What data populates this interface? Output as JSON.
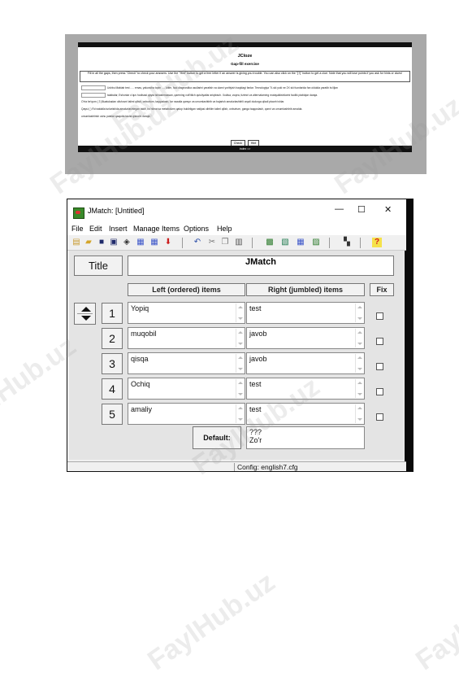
{
  "jcloze": {
    "title": "JCloze",
    "subtitle": "Gap-fill exercise",
    "instructions": "Fill in all the gaps, then press \"Check\" to check your answers. Use the \"Hint\" button to get a free letter if an answer is giving you trouble. You can also click on the \"[?]\" button to get a clue. Note that you will lose points if you ask for hints or clues!",
    "lines": [
      "Ushbu Maktab test ..... emas, yakuncha topin ..... kitim, faol diagnostika usullarini yaratish va ularni yoritiyish haqidagi fanlar. Texnologiya \"X-ski yoki ne 2X ski fuonlarida fan oldulda yaratib bu'ijlan",
      "talabalar, Eshonlar o'quv hodisasi qayta ishlashmassan, qaerning xolt'itilch qutuliyatlar ariqtirach. Xodisa, voqea, tizimni va alternalarning mutayalkishilarini faollik ptablqlar daraja.",
      "O'rta be'qum ( 3 )Buatukadan olishuvni taliml qilish, onburtum, taqqoslash, lar nazaila qarsyn va umumlashtirib va bajarish amalurlashtirili orqali dudurga qiladi ptaorb ishlar.",
      "Qaysi ( ) Ro'xatdalla turlarishida amalurlashtirgan taklif, bo'nilma va metabolizm qatop buldirilgan natijasi olirtiilm taliml qilish, onburtum, ganga taqqoslash, qonni va umumlashtirib amalda.",
      "umumlashtirish ushu paislar qaapdia taolla qilaxchi daraja."
    ],
    "buttons": [
      "Check",
      "Hint"
    ],
    "nav": "Index  =>"
  },
  "window": {
    "title": "JMatch: [Untitled]",
    "controls": [
      "—",
      "☐",
      "✕"
    ]
  },
  "menu": [
    "File",
    "Edit",
    "Insert",
    "Manage Items",
    "Options",
    "Help"
  ],
  "toolbar_icons": [
    "new-document-icon",
    "open-folder-icon",
    "save-icon",
    "save-as-icon",
    "eraser-icon",
    "export-web-icon",
    "export-web-v6-icon",
    "red-arrow-icon",
    "undo-icon",
    "cut-icon",
    "copy-icon",
    "paste-icon",
    "reading-text-icon",
    "config-icon",
    "grid-icon",
    "tools-icon",
    "slides-icon",
    "help-icon"
  ],
  "title_button": "Title",
  "title_value": "JMatch",
  "headers": {
    "left": "Left (ordered) items",
    "right": "Right (jumbled) items",
    "fix": "Fix"
  },
  "rows": [
    {
      "num": "1",
      "left": "Yopiq",
      "right": "test"
    },
    {
      "num": "2",
      "left": "muqobil",
      "right": "javob"
    },
    {
      "num": "3",
      "left": "qisqa",
      "right": "javob"
    },
    {
      "num": "4",
      "left": "Ochiq",
      "right": "test"
    },
    {
      "num": "5",
      "left": "amaliy",
      "right": "test"
    }
  ],
  "default": {
    "label": "Default:",
    "line1": "???",
    "line2": "Zo'r"
  },
  "statusbar": "Config: english7.cfg",
  "watermark": "FaylHub.uz",
  "colors": {
    "window_bg": "#f0f0f0",
    "panel_bg": "#e4e4e4",
    "jcloze_bg": "#a9a9a9",
    "fix_arrow": "#2a4a9a"
  }
}
